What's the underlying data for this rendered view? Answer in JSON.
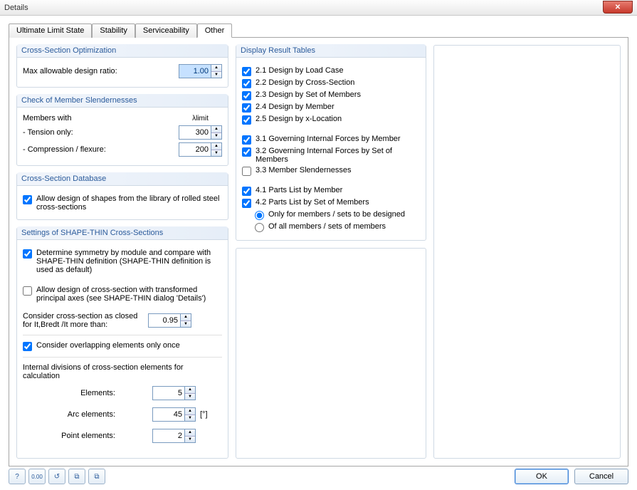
{
  "window": {
    "title": "Details"
  },
  "tabs": {
    "t0": "Ultimate Limit State",
    "t1": "Stability",
    "t2": "Serviceability",
    "t3": "Other"
  },
  "cs_opt": {
    "title": "Cross-Section Optimization",
    "max_ratio_label": "Max allowable design ratio:",
    "max_ratio_value": "1.00"
  },
  "slender": {
    "title": "Check of Member Slendernesses",
    "members_with": "Members with",
    "lambda_limit": "λlimit",
    "tension_label": "- Tension only:",
    "tension_value": "300",
    "compression_label": "- Compression / flexure:",
    "compression_value": "200"
  },
  "cs_db": {
    "title": "Cross-Section Database",
    "allow_library": "Allow design of shapes from the library of rolled steel cross-sections"
  },
  "shape_thin": {
    "title": "Settings of SHAPE-THIN Cross-Sections",
    "determine_symmetry": "Determine symmetry by module and compare with SHAPE-THIN definition (SHAPE-THIN definition is used as default)",
    "allow_transformed": "Allow design of cross-section with transformed principal axes (see SHAPE-THIN dialog 'Details')",
    "closed_label": "Consider cross-section as closed for It,Bredt /It more than:",
    "closed_value": "0.95",
    "overlap": "Consider overlapping elements only once",
    "divisions_title": "Internal divisions of cross-section elements for calculation",
    "elements_label": "Elements:",
    "elements_value": "5",
    "arc_label": "Arc elements:",
    "arc_value": "45",
    "arc_unit": "[°]",
    "point_label": "Point elements:",
    "point_value": "2"
  },
  "display": {
    "title": "Display Result Tables",
    "c21": "2.1 Design by Load Case",
    "c22": "2.2 Design by Cross-Section",
    "c23": "2.3 Design by Set of Members",
    "c24": "2.4 Design by Member",
    "c25": "2.5 Design by x-Location",
    "c31": "3.1 Governing Internal Forces by Member",
    "c32": "3.2 Governing Internal Forces by Set of Members",
    "c33": "3.3 Member Slendernesses",
    "c41": "4.1 Parts List by Member",
    "c42": "4.2 Parts List by Set of Members",
    "r_only": "Only for members / sets to be designed",
    "r_all": "Of all members / sets of members"
  },
  "buttons": {
    "ok": "OK",
    "cancel": "Cancel"
  }
}
